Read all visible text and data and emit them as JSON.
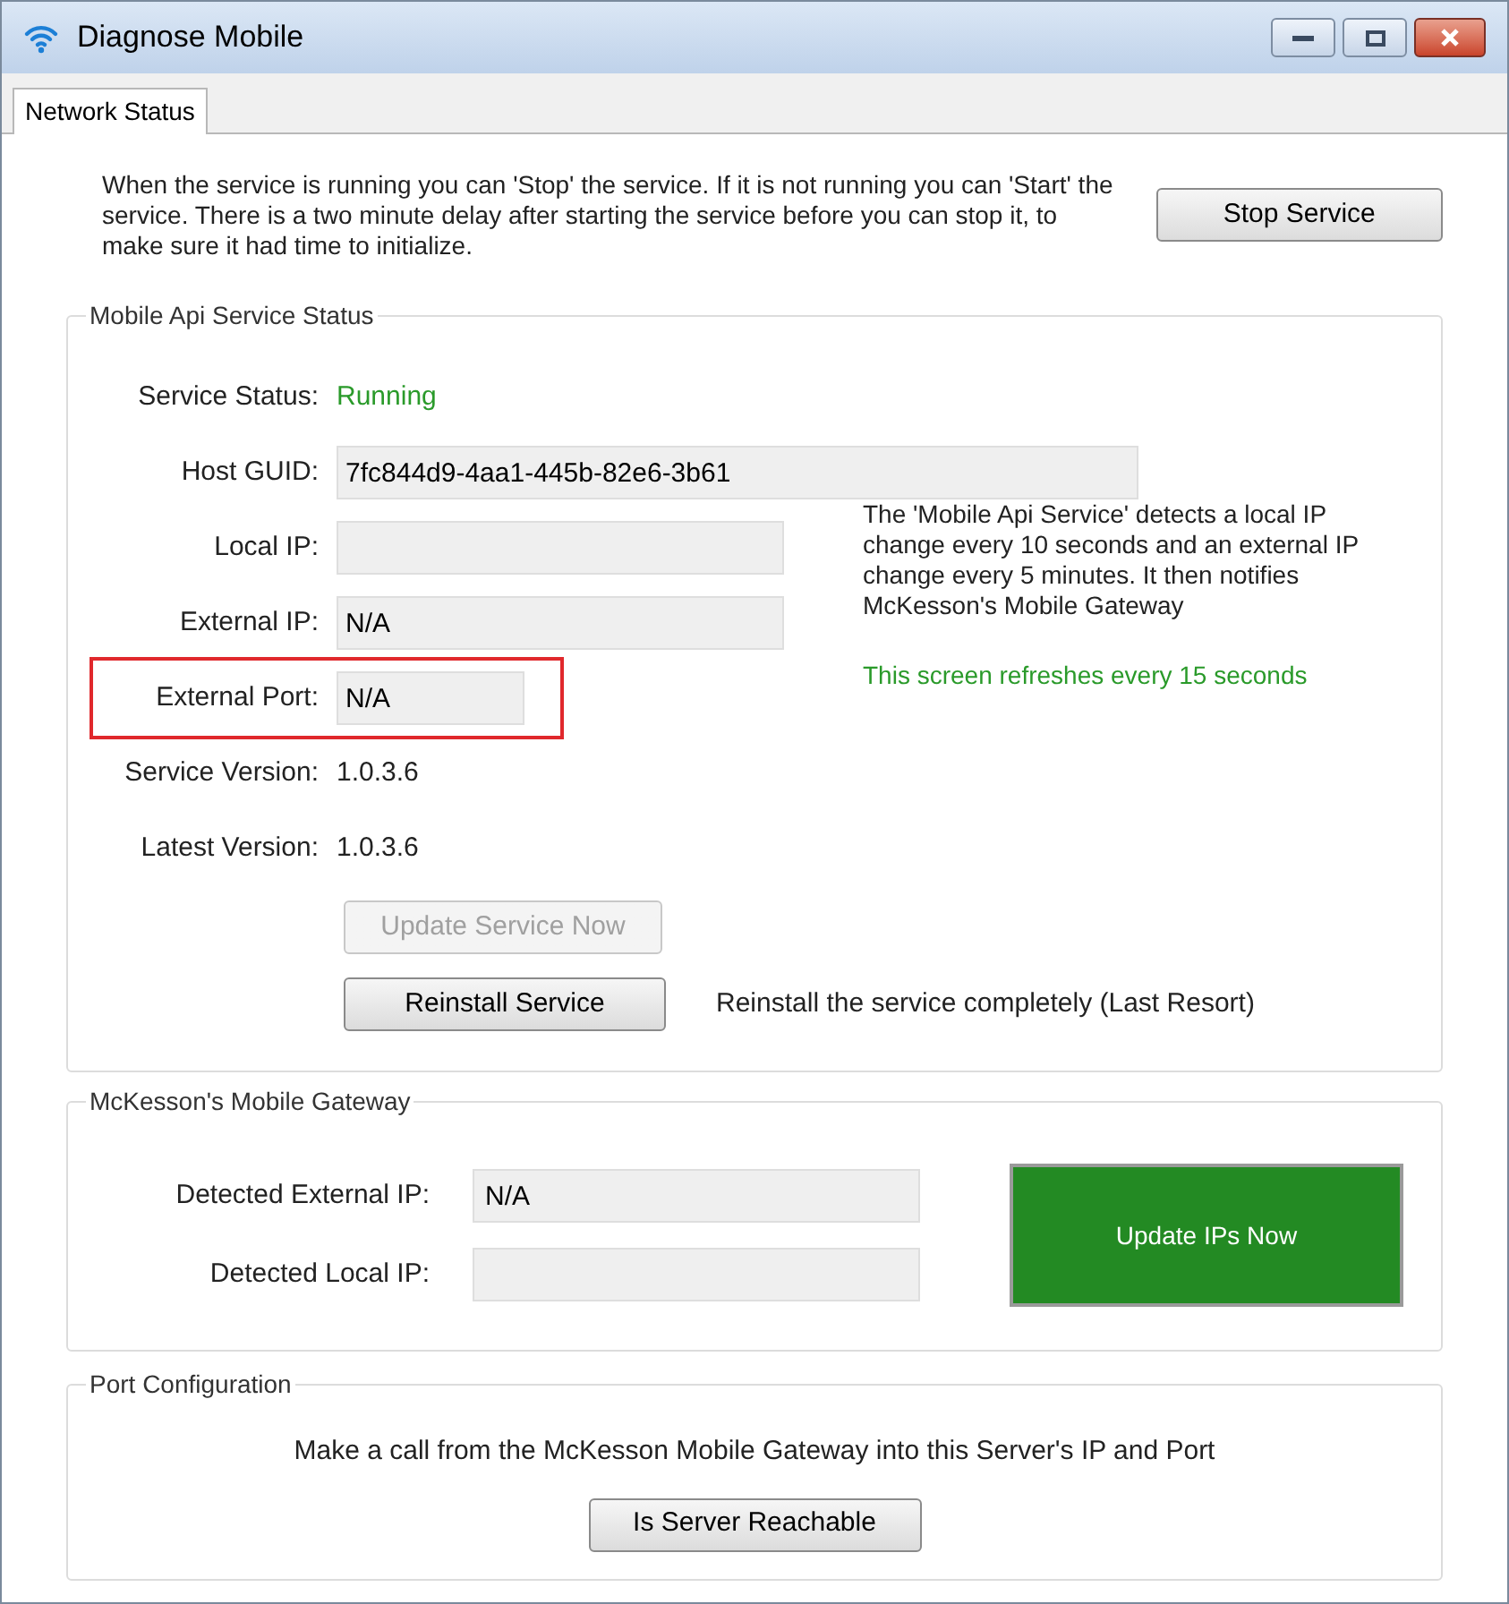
{
  "window": {
    "title": "Diagnose Mobile"
  },
  "tabs": [
    {
      "label": "Network Status",
      "selected": true
    }
  ],
  "intro": {
    "text": "When the service is running you can 'Stop' the service. If it is not running you can 'Start' the service. There is a two minute delay after starting the service before you can stop it, to make sure it had time to initialize.",
    "button": "Stop Service"
  },
  "service_group": {
    "title": "Mobile Api Service Status",
    "fields": [
      {
        "kind": "status",
        "label": "Service Status:",
        "value": "Running",
        "highlighted": false
      },
      {
        "kind": "textbox",
        "label": "Host GUID:",
        "value": "7fc844d9-4aa1-445b-82e6-3b61",
        "highlighted": false
      },
      {
        "kind": "textbox",
        "label": "Local IP:",
        "highlighted": false
      },
      {
        "kind": "textbox",
        "label": "External IP:",
        "value": "N/A",
        "highlighted": false
      },
      {
        "kind": "textbox",
        "label": "External Port:",
        "value": "N/A",
        "highlighted": true
      },
      {
        "kind": "plain",
        "label": "Service Version:",
        "value": "1.0.3.6",
        "highlighted": false
      },
      {
        "kind": "plain",
        "label": "Latest Version:",
        "value": "1.0.3.6",
        "highlighted": false
      }
    ],
    "info": "The 'Mobile Api Service' detects a local IP change every 10 seconds and an external IP change every 5 minutes. It then notifies McKesson's Mobile Gateway",
    "refresh_note": "This screen refreshes every 15 seconds",
    "update_button": {
      "label": "Update Service Now",
      "disabled": true
    },
    "reinstall_button": {
      "label": "Reinstall Service",
      "disabled": false
    },
    "reinstall_note": "Reinstall the service completely (Last Resort)"
  },
  "gateway_group": {
    "title": "McKesson's Mobile Gateway",
    "fields": [
      {
        "label": "Detected External IP:",
        "value": "N/A"
      },
      {
        "label": "Detected Local IP:"
      }
    ],
    "button": "Update IPs Now"
  },
  "port_group": {
    "title": "Port Configuration",
    "text": "Make a call from the McKesson Mobile Gateway into this Server's IP and Port",
    "button": "Is Server Reachable"
  }
}
